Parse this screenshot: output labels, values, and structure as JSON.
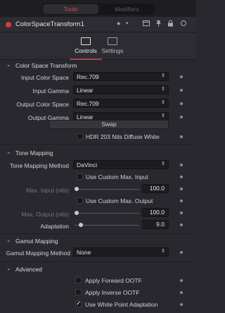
{
  "top_tabs": [
    "Tools",
    "Modifiers"
  ],
  "tool": {
    "title": "ColorSpaceTransform1",
    "icons": [
      "color-dot-icon",
      "chevron-down-icon",
      "versions-icon",
      "pin-icon",
      "lock-icon",
      "reset-icon"
    ]
  },
  "tabs": [
    {
      "label": "Controls",
      "icon": "controls-icon"
    },
    {
      "label": "Settings",
      "icon": "settings-icon"
    }
  ],
  "sections": {
    "color_space": {
      "title": "Color Space Transform",
      "input_color_space": {
        "label": "Input Color Space",
        "value": "Rec.709"
      },
      "input_gamma": {
        "label": "Input Gamma",
        "value": "Linear"
      },
      "output_color_space": {
        "label": "Output Color Space",
        "value": "Rec.709"
      },
      "output_gamma": {
        "label": "Output Gamma",
        "value": "Linear"
      },
      "swap_label": "Swap",
      "hdr_label": "HDR 203 Nits Diffuse White",
      "hdr_checked": false
    },
    "tone_mapping": {
      "title": "Tone Mapping",
      "method": {
        "label": "Tone Mapping Method",
        "value": "DaVinci"
      },
      "custom_max_input": {
        "label": "Use Custom Max. Input",
        "checked": false
      },
      "max_input": {
        "label": "Max. Input (nits)",
        "value": "100.0",
        "level": 0.0
      },
      "custom_max_output": {
        "label": "Use Custom Max. Output",
        "checked": false
      },
      "max_output": {
        "label": "Max. Output (nits)",
        "value": "100.0",
        "level": 0.0
      },
      "adaptation": {
        "label": "Adaptation",
        "value": "9.0",
        "level": 0.0
      }
    },
    "gamut_mapping": {
      "title": "Gamut Mapping",
      "method": {
        "label": "Gamut Mapping Method",
        "value": "None"
      }
    },
    "advanced": {
      "title": "Advanced",
      "forward_ootf": {
        "label": "Apply Forward OOTF",
        "checked": false
      },
      "inverse_ootf": {
        "label": "Apply Inverse OOTF",
        "checked": false
      },
      "white_point": {
        "label": "Use White Point Adaptation",
        "checked": true
      }
    }
  },
  "colors": {
    "accent": "#c03a3a",
    "active_tab_text": "#d84848",
    "node_dot": "#d33c3c"
  }
}
